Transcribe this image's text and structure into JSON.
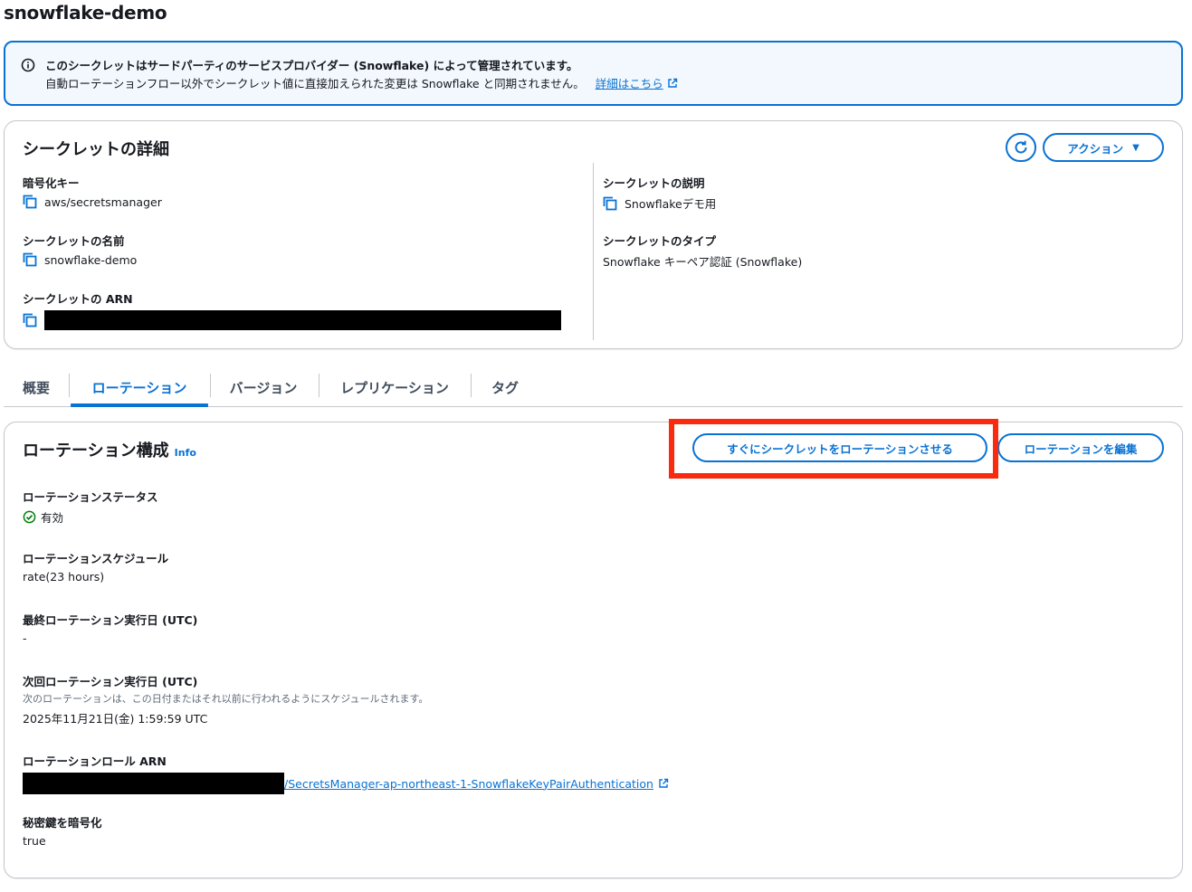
{
  "page": {
    "title": "snowflake-demo"
  },
  "alert": {
    "message_bold": "このシークレットはサードパーティのサービスプロバイダー (Snowflake) によって管理されています。",
    "message": "自動ローテーションフロー以外でシークレット値に直接加えられた変更は Snowflake と同期されません。",
    "link_label": "詳細はこちら"
  },
  "details": {
    "header": "シークレットの詳細",
    "actions_label": "アクション",
    "encryption_key": {
      "label": "暗号化キー",
      "value": "aws/secretsmanager"
    },
    "secret_name": {
      "label": "シークレットの名前",
      "value": "snowflake-demo"
    },
    "secret_arn": {
      "label": "シークレットの ARN"
    },
    "secret_description": {
      "label": "シークレットの説明",
      "value": "Snowflakeデモ用"
    },
    "secret_type": {
      "label": "シークレットのタイプ",
      "value": "Snowflake キーペア認証 (Snowflake)"
    }
  },
  "tabs": [
    {
      "label": "概要"
    },
    {
      "label": "ローテーション",
      "active": true
    },
    {
      "label": "バージョン"
    },
    {
      "label": "レプリケーション"
    },
    {
      "label": "タグ"
    }
  ],
  "rotation": {
    "header": "ローテーション構成",
    "info_label": "Info",
    "rotate_now_label": "すぐにシークレットをローテーションさせる",
    "edit_label": "ローテーションを編集",
    "status": {
      "label": "ローテーションステータス",
      "value": "有効"
    },
    "schedule": {
      "label": "ローテーションスケジュール",
      "value": "rate(23 hours)"
    },
    "last_rotated": {
      "label": "最終ローテーション実行日 (UTC)",
      "value": "-"
    },
    "next_rotation": {
      "label": "次回ローテーション実行日 (UTC)",
      "note": "次のローテーションは、この日付またはそれ以前に行われるようにスケジュールされます。",
      "value": "2025年11月21日(金) 1:59:59 UTC"
    },
    "role_arn": {
      "label": "ローテーションロール ARN",
      "link_suffix": "/SecretsManager-ap-northeast-1-SnowflakeKeyPairAuthentication"
    },
    "encrypt_private_key": {
      "label": "秘密鍵を暗号化",
      "value": "true"
    }
  },
  "colors": {
    "accent": "#0972d3",
    "highlight": "#fa2a0e",
    "success": "#037f0c"
  }
}
